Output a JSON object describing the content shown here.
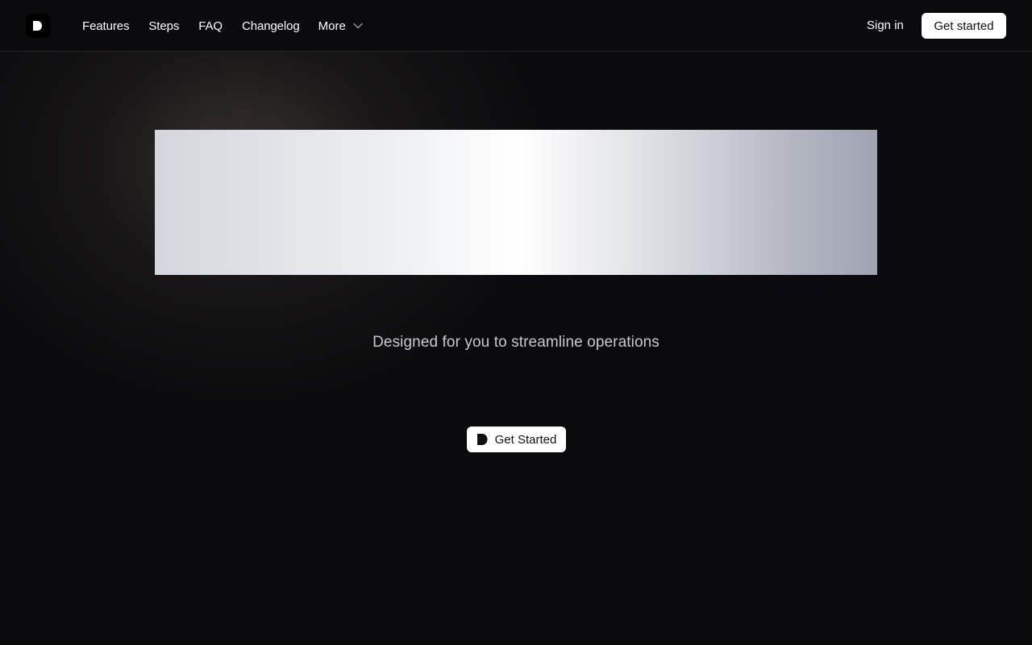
{
  "nav": {
    "logo_icon": "brand-d-logo-icon",
    "links": [
      {
        "label": "Features"
      },
      {
        "label": "Steps"
      },
      {
        "label": "FAQ"
      },
      {
        "label": "Changelog"
      }
    ],
    "more": {
      "label": "More",
      "icon": "chevron-down-icon"
    },
    "sign_in": "Sign in",
    "get_started": "Get started"
  },
  "hero": {
    "tagline": "Designed for you to streamline operations",
    "cta": {
      "label": "Get Started",
      "icon": "brand-d-logo-icon"
    }
  },
  "colors": {
    "background": "#0a0a0c",
    "button_bg": "#ffffff",
    "button_text": "#111111",
    "tagline": "#c9c9cd"
  }
}
